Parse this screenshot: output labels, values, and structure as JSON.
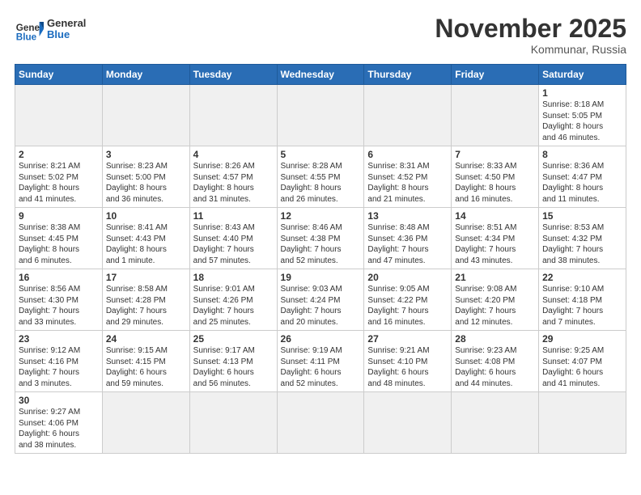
{
  "header": {
    "logo_general": "General",
    "logo_blue": "Blue",
    "month_title": "November 2025",
    "location": "Kommunar, Russia"
  },
  "weekdays": [
    "Sunday",
    "Monday",
    "Tuesday",
    "Wednesday",
    "Thursday",
    "Friday",
    "Saturday"
  ],
  "weeks": [
    [
      {
        "day": "",
        "info": "",
        "empty": true
      },
      {
        "day": "",
        "info": "",
        "empty": true
      },
      {
        "day": "",
        "info": "",
        "empty": true
      },
      {
        "day": "",
        "info": "",
        "empty": true
      },
      {
        "day": "",
        "info": "",
        "empty": true
      },
      {
        "day": "",
        "info": "",
        "empty": true
      },
      {
        "day": "1",
        "info": "Sunrise: 8:18 AM\nSunset: 5:05 PM\nDaylight: 8 hours\nand 46 minutes."
      }
    ],
    [
      {
        "day": "2",
        "info": "Sunrise: 8:21 AM\nSunset: 5:02 PM\nDaylight: 8 hours\nand 41 minutes."
      },
      {
        "day": "3",
        "info": "Sunrise: 8:23 AM\nSunset: 5:00 PM\nDaylight: 8 hours\nand 36 minutes."
      },
      {
        "day": "4",
        "info": "Sunrise: 8:26 AM\nSunset: 4:57 PM\nDaylight: 8 hours\nand 31 minutes."
      },
      {
        "day": "5",
        "info": "Sunrise: 8:28 AM\nSunset: 4:55 PM\nDaylight: 8 hours\nand 26 minutes."
      },
      {
        "day": "6",
        "info": "Sunrise: 8:31 AM\nSunset: 4:52 PM\nDaylight: 8 hours\nand 21 minutes."
      },
      {
        "day": "7",
        "info": "Sunrise: 8:33 AM\nSunset: 4:50 PM\nDaylight: 8 hours\nand 16 minutes."
      },
      {
        "day": "8",
        "info": "Sunrise: 8:36 AM\nSunset: 4:47 PM\nDaylight: 8 hours\nand 11 minutes."
      }
    ],
    [
      {
        "day": "9",
        "info": "Sunrise: 8:38 AM\nSunset: 4:45 PM\nDaylight: 8 hours\nand 6 minutes."
      },
      {
        "day": "10",
        "info": "Sunrise: 8:41 AM\nSunset: 4:43 PM\nDaylight: 8 hours\nand 1 minute."
      },
      {
        "day": "11",
        "info": "Sunrise: 8:43 AM\nSunset: 4:40 PM\nDaylight: 7 hours\nand 57 minutes."
      },
      {
        "day": "12",
        "info": "Sunrise: 8:46 AM\nSunset: 4:38 PM\nDaylight: 7 hours\nand 52 minutes."
      },
      {
        "day": "13",
        "info": "Sunrise: 8:48 AM\nSunset: 4:36 PM\nDaylight: 7 hours\nand 47 minutes."
      },
      {
        "day": "14",
        "info": "Sunrise: 8:51 AM\nSunset: 4:34 PM\nDaylight: 7 hours\nand 43 minutes."
      },
      {
        "day": "15",
        "info": "Sunrise: 8:53 AM\nSunset: 4:32 PM\nDaylight: 7 hours\nand 38 minutes."
      }
    ],
    [
      {
        "day": "16",
        "info": "Sunrise: 8:56 AM\nSunset: 4:30 PM\nDaylight: 7 hours\nand 33 minutes."
      },
      {
        "day": "17",
        "info": "Sunrise: 8:58 AM\nSunset: 4:28 PM\nDaylight: 7 hours\nand 29 minutes."
      },
      {
        "day": "18",
        "info": "Sunrise: 9:01 AM\nSunset: 4:26 PM\nDaylight: 7 hours\nand 25 minutes."
      },
      {
        "day": "19",
        "info": "Sunrise: 9:03 AM\nSunset: 4:24 PM\nDaylight: 7 hours\nand 20 minutes."
      },
      {
        "day": "20",
        "info": "Sunrise: 9:05 AM\nSunset: 4:22 PM\nDaylight: 7 hours\nand 16 minutes."
      },
      {
        "day": "21",
        "info": "Sunrise: 9:08 AM\nSunset: 4:20 PM\nDaylight: 7 hours\nand 12 minutes."
      },
      {
        "day": "22",
        "info": "Sunrise: 9:10 AM\nSunset: 4:18 PM\nDaylight: 7 hours\nand 7 minutes."
      }
    ],
    [
      {
        "day": "23",
        "info": "Sunrise: 9:12 AM\nSunset: 4:16 PM\nDaylight: 7 hours\nand 3 minutes."
      },
      {
        "day": "24",
        "info": "Sunrise: 9:15 AM\nSunset: 4:15 PM\nDaylight: 6 hours\nand 59 minutes."
      },
      {
        "day": "25",
        "info": "Sunrise: 9:17 AM\nSunset: 4:13 PM\nDaylight: 6 hours\nand 56 minutes."
      },
      {
        "day": "26",
        "info": "Sunrise: 9:19 AM\nSunset: 4:11 PM\nDaylight: 6 hours\nand 52 minutes."
      },
      {
        "day": "27",
        "info": "Sunrise: 9:21 AM\nSunset: 4:10 PM\nDaylight: 6 hours\nand 48 minutes."
      },
      {
        "day": "28",
        "info": "Sunrise: 9:23 AM\nSunset: 4:08 PM\nDaylight: 6 hours\nand 44 minutes."
      },
      {
        "day": "29",
        "info": "Sunrise: 9:25 AM\nSunset: 4:07 PM\nDaylight: 6 hours\nand 41 minutes."
      }
    ],
    [
      {
        "day": "30",
        "info": "Sunrise: 9:27 AM\nSunset: 4:06 PM\nDaylight: 6 hours\nand 38 minutes.",
        "last": true
      },
      {
        "day": "",
        "info": "",
        "empty": true,
        "last": true
      },
      {
        "day": "",
        "info": "",
        "empty": true,
        "last": true
      },
      {
        "day": "",
        "info": "",
        "empty": true,
        "last": true
      },
      {
        "day": "",
        "info": "",
        "empty": true,
        "last": true
      },
      {
        "day": "",
        "info": "",
        "empty": true,
        "last": true
      },
      {
        "day": "",
        "info": "",
        "empty": true,
        "last": true
      }
    ]
  ]
}
